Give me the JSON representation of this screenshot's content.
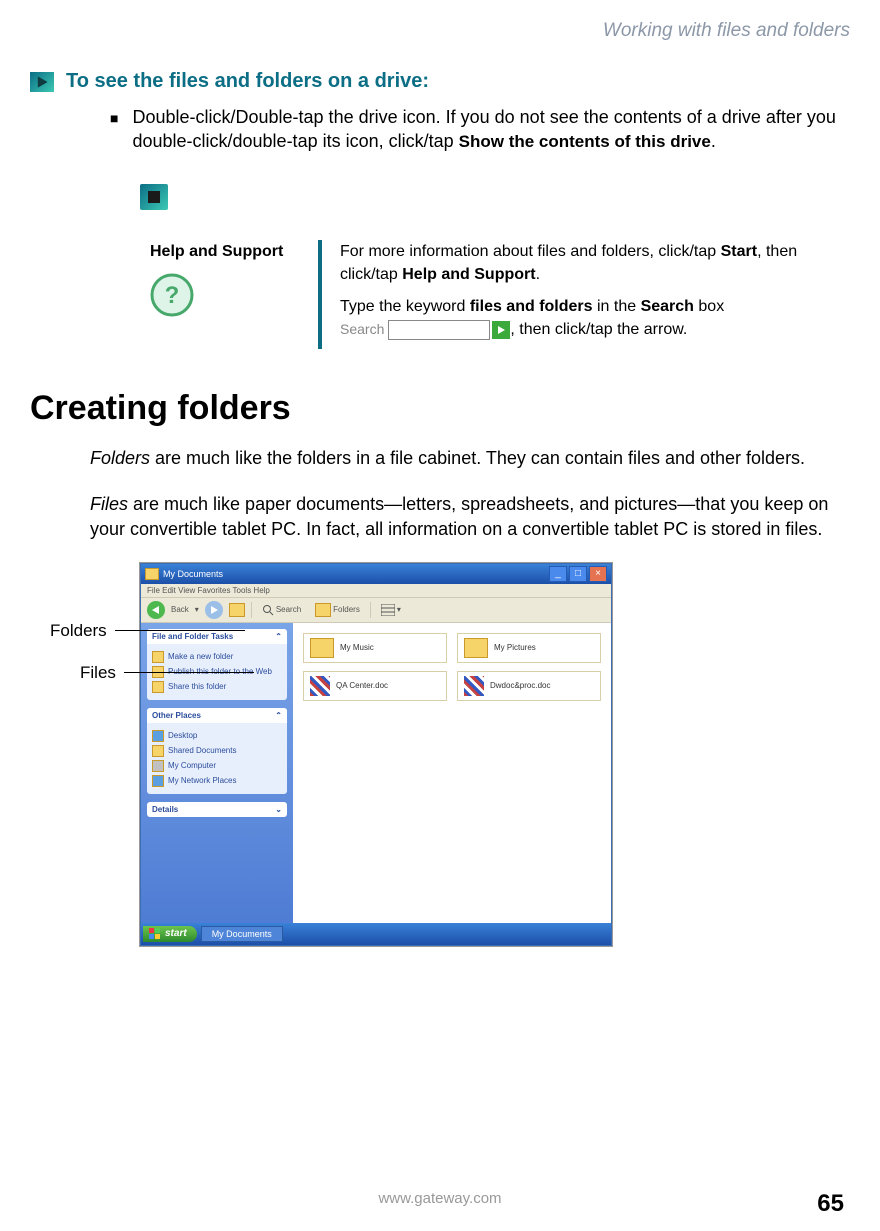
{
  "breadcrumb": "Working with files and folders",
  "section": {
    "title": "To see the files and folders on a drive:",
    "bullet_text_1": "Double-click/Double-tap the drive icon. If you do not see the contents of a drive after you double-click/double-tap its icon, click/tap ",
    "bullet_bold_1": "Show the contents of this drive",
    "bullet_text_2": "."
  },
  "help": {
    "label": "Help and Support",
    "p1_a": "For more information about files and folders, click/tap ",
    "p1_b": "Start",
    "p1_c": ", then click/tap ",
    "p1_d": "Help and Support",
    "p1_e": ".",
    "p2_a": "Type the keyword ",
    "p2_b": "files and folders",
    "p2_c": " in the ",
    "p2_d": "Search",
    "p2_e": " box ",
    "p2_f": ", then click/tap the arrow.",
    "search_label": "Search"
  },
  "h2": "Creating folders",
  "para1_a": "Folders",
  "para1_b": " are much like the folders in a file cabinet. They can contain files and other folders.",
  "para2_a": "Files",
  "para2_b": " are much like paper documents—letters, spreadsheets, and pictures—that you keep on your convertible tablet PC. In fact, all information on a convertible tablet PC is stored in files.",
  "callouts": {
    "folders": "Folders",
    "files": "Files"
  },
  "screenshot": {
    "title": "My Documents",
    "menu": "File   Edit   View   Favorites   Tools   Help",
    "back": "Back",
    "search": "Search",
    "folders": "Folders",
    "panel1_title": "File and Folder Tasks",
    "panel1_items": [
      "Make a new folder",
      "Publish this folder to the Web",
      "Share this folder"
    ],
    "panel2_title": "Other Places",
    "panel2_items": [
      "Desktop",
      "Shared Documents",
      "My Computer",
      "My Network Places"
    ],
    "panel3_title": "Details",
    "items": [
      "My Music",
      "My Pictures",
      "QA Center.doc",
      "Dwdoc&proc.doc"
    ],
    "start": "start",
    "taskbtn": "My Documents"
  },
  "footer": {
    "url": "www.gateway.com",
    "page": "65"
  }
}
